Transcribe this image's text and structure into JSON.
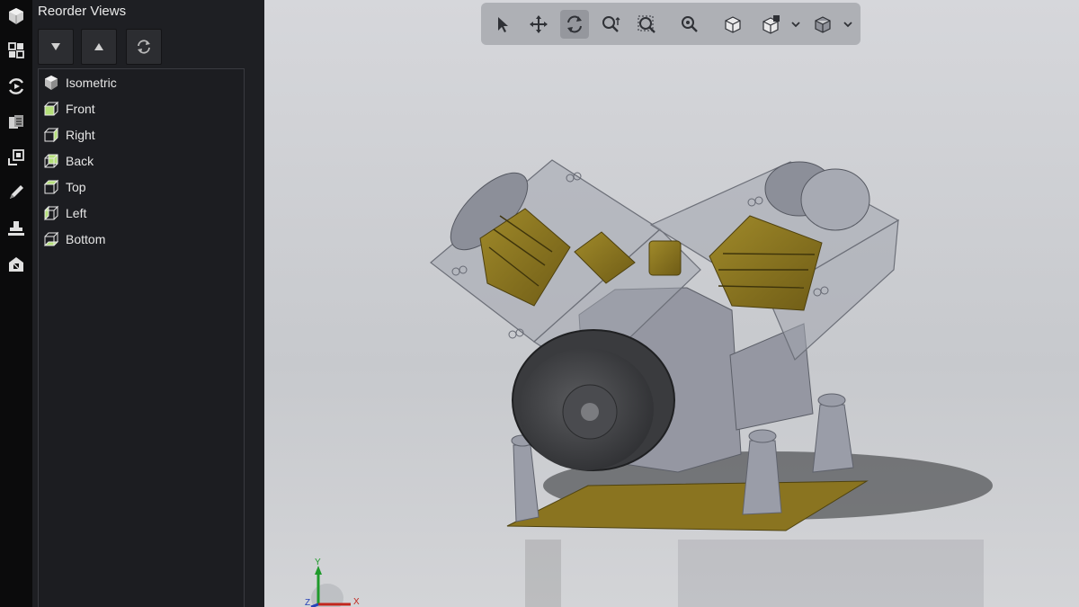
{
  "panel": {
    "title": "Reorder Views",
    "buttons": [
      {
        "name": "move-down",
        "icon": "triangle-down-icon"
      },
      {
        "name": "move-up",
        "icon": "triangle-up-icon"
      },
      {
        "name": "reset",
        "icon": "refresh-icon"
      }
    ],
    "views": [
      {
        "label": "Isometric",
        "icon": "isometric-cube-icon"
      },
      {
        "label": "Front",
        "icon": "front-view-icon"
      },
      {
        "label": "Right",
        "icon": "right-view-icon"
      },
      {
        "label": "Back",
        "icon": "back-view-icon"
      },
      {
        "label": "Top",
        "icon": "top-view-icon"
      },
      {
        "label": "Left",
        "icon": "left-view-icon"
      },
      {
        "label": "Bottom",
        "icon": "bottom-view-icon"
      }
    ]
  },
  "sidebar": {
    "items": [
      "cube-icon",
      "views-grid-icon",
      "animation-icon",
      "parts-list-icon",
      "bom-icon",
      "markup-pencil-icon",
      "stamp-icon",
      "share-icon"
    ]
  },
  "viewport_toolbar": {
    "tools": [
      "select-arrow-icon",
      "pan-icon",
      "rotate-icon",
      "zoom-icon",
      "zoom-to-area-icon",
      "zoom-fit-icon",
      "standard-views-icon",
      "view-orientation-icon",
      "display-style-icon"
    ],
    "active": "rotate-icon"
  },
  "triad": {
    "x_label": "X",
    "y_label": "Y",
    "z_label": "Z"
  },
  "colors": {
    "accent_green": "#b5e07a",
    "panel_bg": "#1e1f23",
    "viewport_bg": "#cfd0d4",
    "model_gold": "#8a7420"
  }
}
